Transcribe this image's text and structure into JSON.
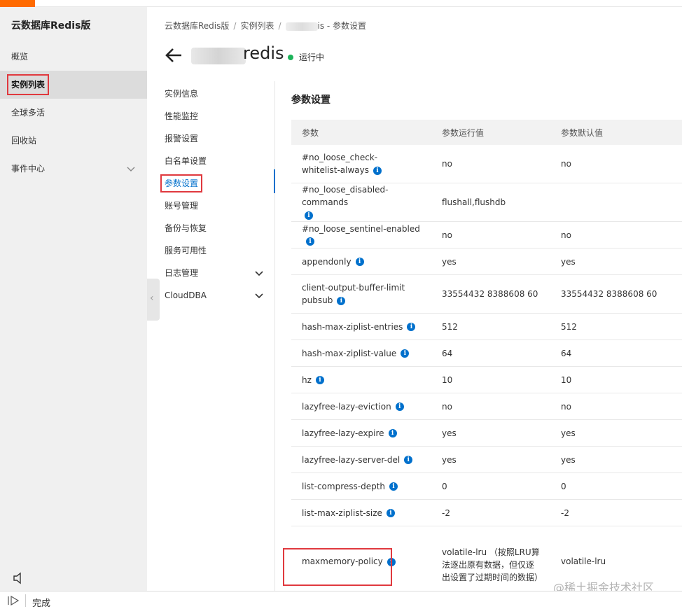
{
  "app": {
    "title": "云数据库Redis版"
  },
  "sidebar": {
    "items": [
      {
        "label": "概览"
      },
      {
        "label": "实例列表"
      },
      {
        "label": "全球多活"
      },
      {
        "label": "回收站"
      },
      {
        "label": "事件中心"
      }
    ]
  },
  "breadcrumb": {
    "root": "云数据库Redis版",
    "list": "实例列表",
    "current": "is - 参数设置"
  },
  "instance": {
    "name": "redis",
    "status": "运行中",
    "status_color": "#1cb35a"
  },
  "subnav": {
    "items": [
      {
        "label": "实例信息"
      },
      {
        "label": "性能监控"
      },
      {
        "label": "报警设置"
      },
      {
        "label": "白名单设置"
      },
      {
        "label": "参数设置"
      },
      {
        "label": "账号管理"
      },
      {
        "label": "备份与恢复"
      },
      {
        "label": "服务可用性"
      },
      {
        "label": "日志管理"
      },
      {
        "label": "CloudDBA"
      }
    ]
  },
  "params": {
    "title": "参数设置",
    "columns": [
      "参数",
      "参数运行值",
      "参数默认值"
    ],
    "rows": [
      {
        "name": "#no_loose_check-whitelist-always",
        "running": "no",
        "default": "no"
      },
      {
        "name": "#no_loose_disabled-commands",
        "running": "flushall,flushdb",
        "default": ""
      },
      {
        "name": "#no_loose_sentinel-enabled",
        "running": "no",
        "default": "no"
      },
      {
        "name": "appendonly",
        "running": "yes",
        "default": "yes"
      },
      {
        "name": "client-output-buffer-limit pubsub",
        "running": "33554432 8388608 60",
        "default": "33554432 8388608 60"
      },
      {
        "name": "hash-max-ziplist-entries",
        "running": "512",
        "default": "512"
      },
      {
        "name": "hash-max-ziplist-value",
        "running": "64",
        "default": "64"
      },
      {
        "name": "hz",
        "running": "10",
        "default": "10"
      },
      {
        "name": "lazyfree-lazy-eviction",
        "running": "no",
        "default": "no"
      },
      {
        "name": "lazyfree-lazy-expire",
        "running": "yes",
        "default": "yes"
      },
      {
        "name": "lazyfree-lazy-server-del",
        "running": "yes",
        "default": "yes"
      },
      {
        "name": "list-compress-depth",
        "running": "0",
        "default": "0"
      },
      {
        "name": "list-max-ziplist-size",
        "running": "-2",
        "default": "-2"
      },
      {
        "name": "maxmemory-policy",
        "running": "volatile-lru （按照LRU算法逐出原有数据，但仅逐出设置了过期时间的数据）",
        "default": "volatile-lru"
      }
    ]
  },
  "statusbar": {
    "text": "完成"
  },
  "watermark": "@稀土掘金技术社区",
  "colors": {
    "accent": "#ff6a00",
    "link": "#0070cc",
    "highlight": "#e0393e"
  }
}
